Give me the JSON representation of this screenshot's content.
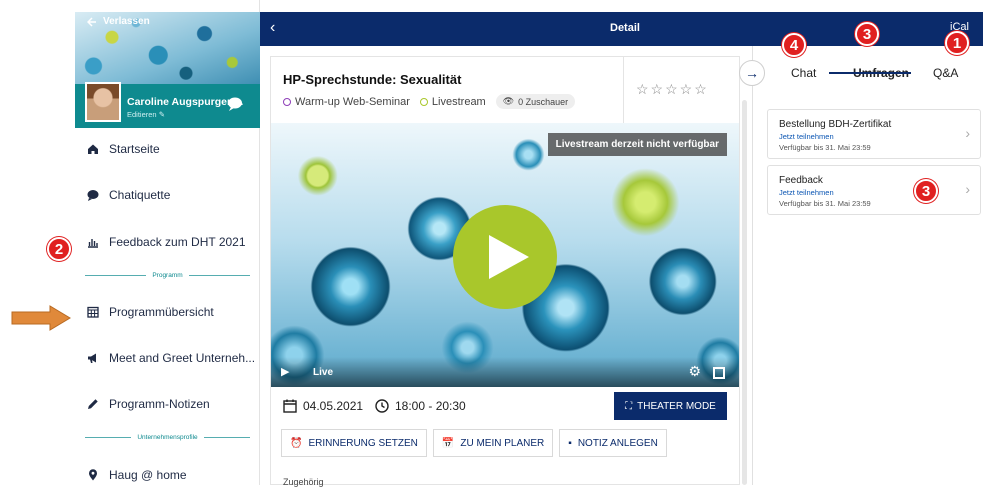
{
  "sidebar": {
    "back_label": "Verlassen",
    "user_name": "Caroline Augspurger-...",
    "edit_label": "Editieren",
    "items": [
      {
        "label": "Startseite",
        "icon": "home-icon"
      },
      {
        "label": "Chatiquette",
        "icon": "chat-bubble-icon"
      },
      {
        "label": "Feedback zum DHT 2021",
        "icon": "bar-chart-icon"
      },
      {
        "label": "Programmübersicht",
        "icon": "calendar-grid-icon"
      },
      {
        "label": "Meet and Greet Unterneh...",
        "icon": "megaphone-icon"
      },
      {
        "label": "Programm-Notizen",
        "icon": "pencil-icon"
      },
      {
        "label": "Haug @ home",
        "icon": "location-pin-icon"
      }
    ],
    "section_program": "Programm",
    "section_companies": "Unternehmensprofile"
  },
  "topbar": {
    "title": "Detail",
    "ical": "iCal"
  },
  "event": {
    "title": "HP-Sprechstunde: Sexualität",
    "tag1": "Warm-up Web-Seminar",
    "tag2": "Livestream",
    "viewers": "0 Zuschauer",
    "stars": "☆☆☆☆☆",
    "stream_status": "Livestream derzeit nicht verfügbar",
    "live_label": "Live",
    "date": "04.05.2021",
    "time": "18:00 - 20:30",
    "theater_mode": "THEATER MODE",
    "btn_reminder": "ERINNERUNG SETZEN",
    "btn_planner": "ZU MEIN PLANER",
    "btn_note": "NOTIZ ANLEGEN",
    "footer_text": "Zugehörig"
  },
  "panel": {
    "tabs": [
      "Chat",
      "Umfragen",
      "Q&A"
    ],
    "active_tab": "Umfragen",
    "surveys": [
      {
        "title": "Bestellung BDH-Zertifikat",
        "link": "Jetzt teilnehmen",
        "deadline": "Verfügbar bis 31. Mai 23:59"
      },
      {
        "title": "Feedback",
        "link": "Jetzt teilnehmen",
        "deadline": "Verfügbar bis 31. Mai 23:59"
      }
    ]
  },
  "annotations": {
    "badge_1": "1",
    "badge_2": "2",
    "badge_3a": "3",
    "badge_3b": "3",
    "badge_4": "4"
  },
  "colors": {
    "navy": "#0b2b6b",
    "teal": "#0e8a8f",
    "lime": "#a9c72b",
    "badge_red": "#e02020",
    "arrow_orange": "#e0893a"
  }
}
